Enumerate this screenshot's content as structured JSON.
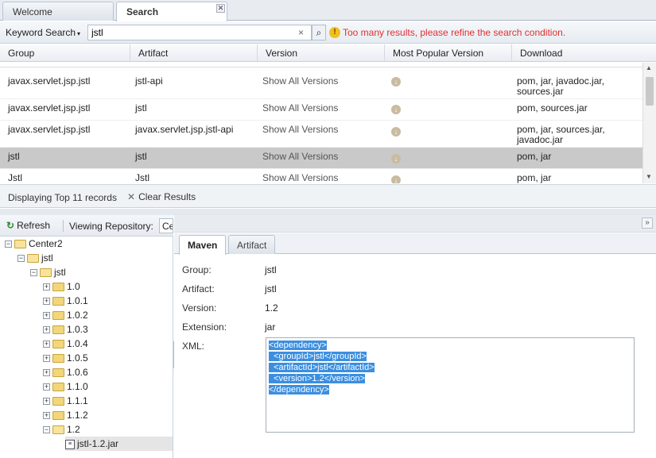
{
  "tabs": [
    {
      "label": "Welcome"
    },
    {
      "label": "Search"
    }
  ],
  "search": {
    "scope_label": "Keyword Search",
    "value": "jstl",
    "clear_glyph": "×",
    "button_glyph": "⌕",
    "warning_text": "Too many results, please refine the search condition."
  },
  "grid": {
    "columns": [
      "Group",
      "Artifact",
      "Version",
      "Most Popular Version",
      "Download"
    ],
    "rows": [
      {
        "group": "javax.servlet.jsp.jstl",
        "artifact": "jstl-api",
        "version": "Show All Versions",
        "download": "pom, jar, javadoc.jar, sources.jar",
        "selected": false
      },
      {
        "group": "javax.servlet.jsp.jstl",
        "artifact": "jstl",
        "version": "Show All Versions",
        "download": "pom, sources.jar",
        "selected": false
      },
      {
        "group": "javax.servlet.jsp.jstl",
        "artifact": "javax.servlet.jsp.jstl-api",
        "version": "Show All Versions",
        "download": "pom, jar, sources.jar, javadoc.jar",
        "selected": false
      },
      {
        "group": "jstl",
        "artifact": "jstl",
        "version": "Show All Versions",
        "download": "pom, jar",
        "selected": true
      },
      {
        "group": "Jstl",
        "artifact": "Jstl",
        "version": "Show All Versions",
        "download": "pom, jar",
        "selected": false
      }
    ],
    "footer_text": "Displaying Top 11 records",
    "clear_results_label": "Clear Results"
  },
  "tree_panel": {
    "refresh_label": "Refresh",
    "repo_label": "Viewing Repository:",
    "repo_value": "Central",
    "nodes": [
      {
        "label": "Center2",
        "type": "folder",
        "depth": 0,
        "expander": "−"
      },
      {
        "label": "jstl",
        "type": "folder",
        "depth": 1,
        "expander": "−"
      },
      {
        "label": "jstl",
        "type": "folder",
        "depth": 2,
        "expander": "−"
      },
      {
        "label": "1.0",
        "type": "folder",
        "depth": 3,
        "expander": "+"
      },
      {
        "label": "1.0.1",
        "type": "folder",
        "depth": 3,
        "expander": "+"
      },
      {
        "label": "1.0.2",
        "type": "folder",
        "depth": 3,
        "expander": "+"
      },
      {
        "label": "1.0.3",
        "type": "folder",
        "depth": 3,
        "expander": "+"
      },
      {
        "label": "1.0.4",
        "type": "folder",
        "depth": 3,
        "expander": "+"
      },
      {
        "label": "1.0.5",
        "type": "folder",
        "depth": 3,
        "expander": "+"
      },
      {
        "label": "1.0.6",
        "type": "folder",
        "depth": 3,
        "expander": "+"
      },
      {
        "label": "1.1.0",
        "type": "folder",
        "depth": 3,
        "expander": "+"
      },
      {
        "label": "1.1.1",
        "type": "folder",
        "depth": 3,
        "expander": "+"
      },
      {
        "label": "1.1.2",
        "type": "folder",
        "depth": 3,
        "expander": "+"
      },
      {
        "label": "1.2",
        "type": "folder",
        "depth": 3,
        "expander": "−"
      },
      {
        "label": "jstl-1.2.jar",
        "type": "file",
        "depth": 4,
        "expander": ""
      }
    ]
  },
  "detail": {
    "tabs": [
      "Maven",
      "Artifact"
    ],
    "fields": [
      {
        "label": "Group:",
        "value": "jstl"
      },
      {
        "label": "Artifact:",
        "value": "jstl"
      },
      {
        "label": "Version:",
        "value": "1.2"
      },
      {
        "label": "Extension:",
        "value": "jar"
      }
    ],
    "xml_label": "XML:",
    "xml_lines": [
      "<dependency>",
      "  <groupId>jstl</groupId>",
      "  <artifactId>jstl</artifactId>",
      "  <version>1.2</version>",
      "</dependency>"
    ]
  },
  "colors": {
    "warning": "#e03030",
    "selection": "#c9c9c9",
    "xml_highlight": "#3b8fe0"
  }
}
